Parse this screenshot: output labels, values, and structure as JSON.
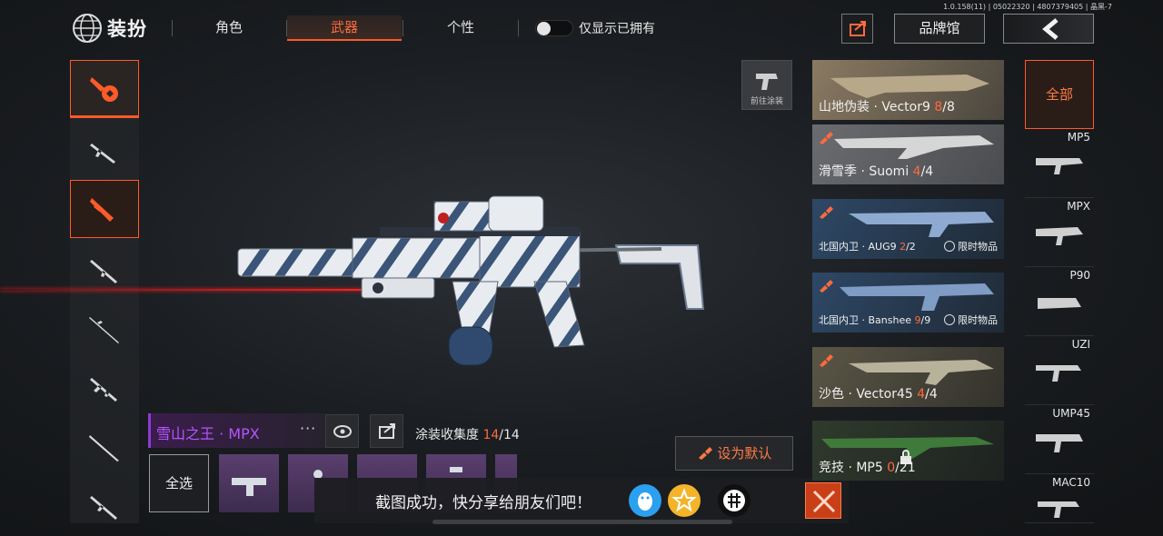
{
  "version_info": "1.0.158(11) | 05022320 | 4807379405 | 晶黑-7",
  "header": {
    "title": "装扮",
    "tabs": [
      {
        "label": "角色",
        "active": false
      },
      {
        "label": "武器",
        "active": true
      },
      {
        "label": "个性",
        "active": false
      }
    ],
    "toggle_label": "仅显示已拥有",
    "toggle_on": false,
    "brand_button": "品牌馆"
  },
  "left_categories": [
    {
      "icon": "weapon-paint-icon",
      "selected": false
    },
    {
      "icon": "assault-rifle-icon",
      "selected": false
    },
    {
      "icon": "smg-icon",
      "selected": true
    },
    {
      "icon": "shotgun-icon",
      "selected": false
    },
    {
      "icon": "sniper-rifle-icon",
      "selected": false
    },
    {
      "icon": "lmg-icon",
      "selected": false
    },
    {
      "icon": "marksman-rifle-icon",
      "selected": false
    },
    {
      "icon": "rifle-icon",
      "selected": false
    }
  ],
  "goto_paint_label": "前往涂装",
  "current_skin": {
    "name": "雪山之王 · MPX",
    "more": "···",
    "collection_label": "涂装收集度",
    "collection_current": "14",
    "collection_total": "/14"
  },
  "set_default_label": "设为默认",
  "select_all_label": "全选",
  "toast": {
    "text": "截图成功，快分享给朋友们吧！",
    "share_icons": [
      "qq-icon",
      "qzone-icon",
      "share-app-icon"
    ]
  },
  "skin_list": [
    {
      "name": "山地伪装 · Vector9 ",
      "count": "8",
      "total": "/8",
      "tag": ""
    },
    {
      "name": "滑雪季 · Suomi ",
      "count": "4",
      "total": "/4",
      "tag": ""
    },
    {
      "name": "北国内卫 · AUG9 ",
      "count": "2",
      "total": "/2",
      "tag": "限时物品"
    },
    {
      "name": "北国内卫 · Banshee ",
      "count": "9",
      "total": "/9",
      "tag": "限时物品"
    },
    {
      "name": "沙色 · Vector45 ",
      "count": "4",
      "total": "/4",
      "tag": ""
    },
    {
      "name": "竞技 · MP5 ",
      "count": "0",
      "total": "/21",
      "tag": ""
    }
  ],
  "weapon_types": {
    "all_label": "全部",
    "items": [
      "MP5",
      "MPX",
      "P90",
      "UZI",
      "UMP45",
      "MAC10"
    ]
  },
  "colors": {
    "accent": "#ff5a2a",
    "skin_purple": "#b455ff",
    "laser": "#ff2020"
  }
}
